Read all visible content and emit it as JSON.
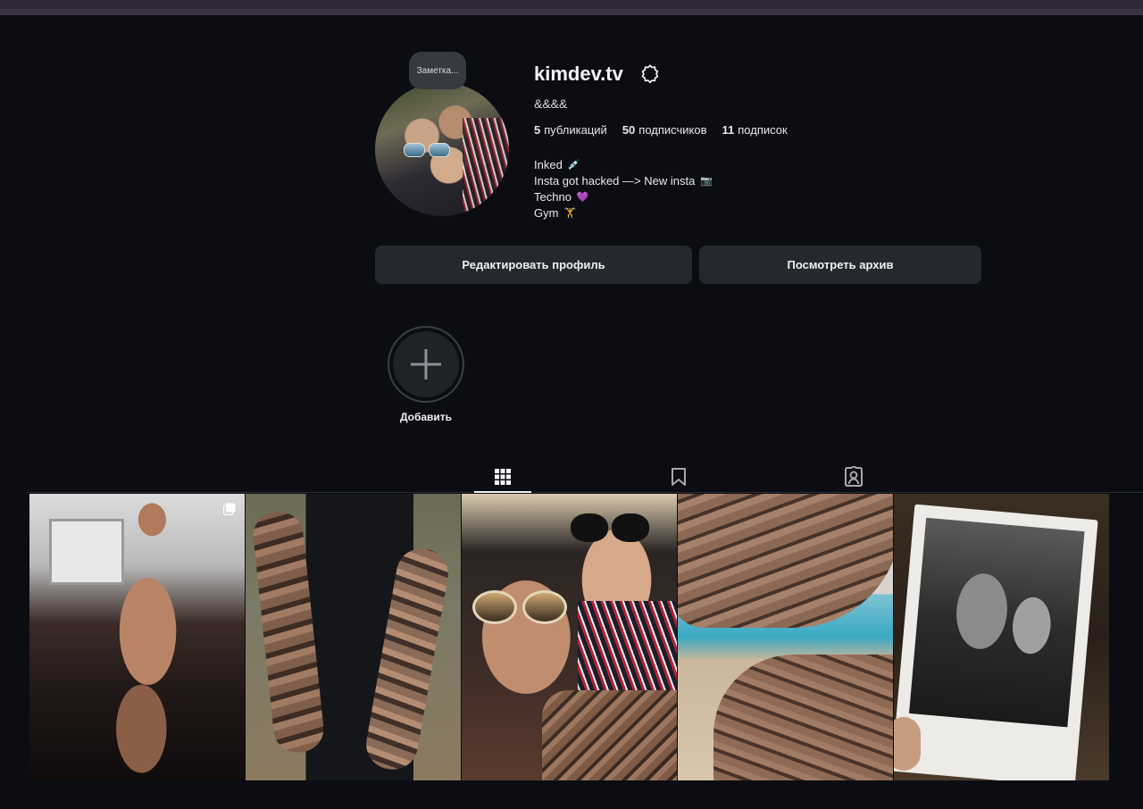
{
  "profile": {
    "username": "kimdev.tv",
    "subtitle": "&&&&",
    "note": "Заметка...",
    "stats": {
      "posts_count": "5",
      "posts_label": "публикаций",
      "followers_count": "50",
      "followers_label": "подписчиков",
      "following_count": "11",
      "following_label": "подписок"
    },
    "bio": [
      {
        "text": "Inked",
        "emoji": "💉"
      },
      {
        "text": "Insta got hacked —> New insta",
        "emoji": "📷"
      },
      {
        "text": "Techno",
        "emoji": "💜"
      },
      {
        "text": "Gym",
        "emoji": "🏋"
      }
    ]
  },
  "buttons": {
    "edit_profile": "Редактировать профиль",
    "view_archive": "Посмотреть архив"
  },
  "highlights": {
    "add_label": "Добавить"
  },
  "tabs": [
    {
      "name": "posts",
      "icon": "grid-icon",
      "active": true
    },
    {
      "name": "saved",
      "icon": "bookmark-icon",
      "active": false
    },
    {
      "name": "tagged",
      "icon": "tagged-user-icon",
      "active": false
    }
  ],
  "posts": [
    {
      "id": "post-1",
      "multi": true
    },
    {
      "id": "post-2",
      "multi": false
    },
    {
      "id": "post-3",
      "multi": false
    },
    {
      "id": "post-4",
      "multi": false
    },
    {
      "id": "post-5",
      "multi": false
    }
  ],
  "colors": {
    "background": "#0b0d12",
    "button": "#25282e",
    "text": "#f5f5f5"
  }
}
